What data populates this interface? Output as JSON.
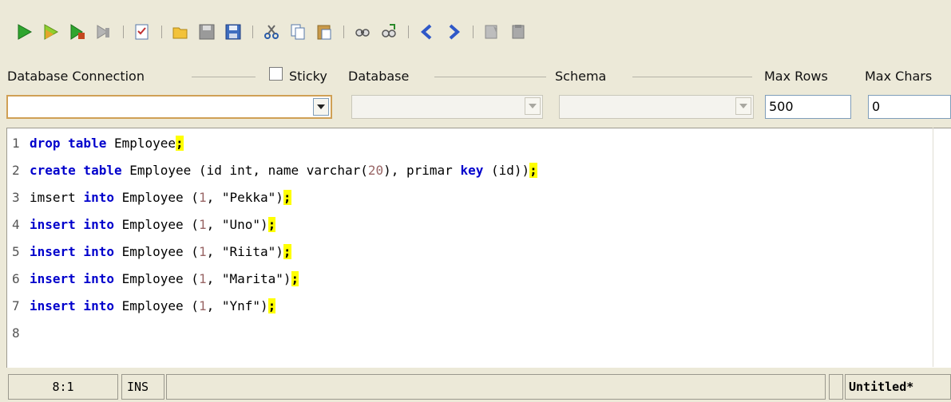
{
  "toolbar": {
    "icons": [
      "run-icon",
      "run-step-icon",
      "run-partial-icon",
      "stop-icon",
      "checklist-icon",
      "open-folder-icon",
      "save-icon",
      "save-as-icon",
      "cut-icon",
      "copy-icon",
      "paste-icon",
      "find-icon",
      "replace-icon",
      "back-icon",
      "forward-icon",
      "comment-icon",
      "uncomment-icon"
    ]
  },
  "connection": {
    "database_connection_label": "Database Connection",
    "sticky_label": "Sticky",
    "database_label": "Database",
    "schema_label": "Schema",
    "max_rows_label": "Max Rows",
    "max_chars_label": "Max Chars",
    "database_connection_value": "",
    "database_value": "",
    "schema_value": "",
    "max_rows_value": "500",
    "max_chars_value": "0"
  },
  "editor": {
    "lines": [
      {
        "n": "1",
        "t": "drop table Employee;"
      },
      {
        "n": "2",
        "t": "create table Employee (id int, name varchar(20), primar key (id));"
      },
      {
        "n": "3",
        "t": "imsert into Employee (1, \"Pekka\");"
      },
      {
        "n": "4",
        "t": "insert into Employee (1, \"Uno\");"
      },
      {
        "n": "5",
        "t": "insert into Employee (1, \"Riita\");"
      },
      {
        "n": "6",
        "t": "insert into Employee (1, \"Marita\");"
      },
      {
        "n": "7",
        "t": "insert into Employee (1, \"Ynf\");"
      },
      {
        "n": "8",
        "t": ""
      }
    ]
  },
  "status": {
    "position": "8:1",
    "mode": "INS",
    "document": "Untitled*"
  },
  "colors": {
    "keyword": "#0000cc",
    "number_literal": "#996666",
    "semicolon_highlight": "#ffff00"
  }
}
